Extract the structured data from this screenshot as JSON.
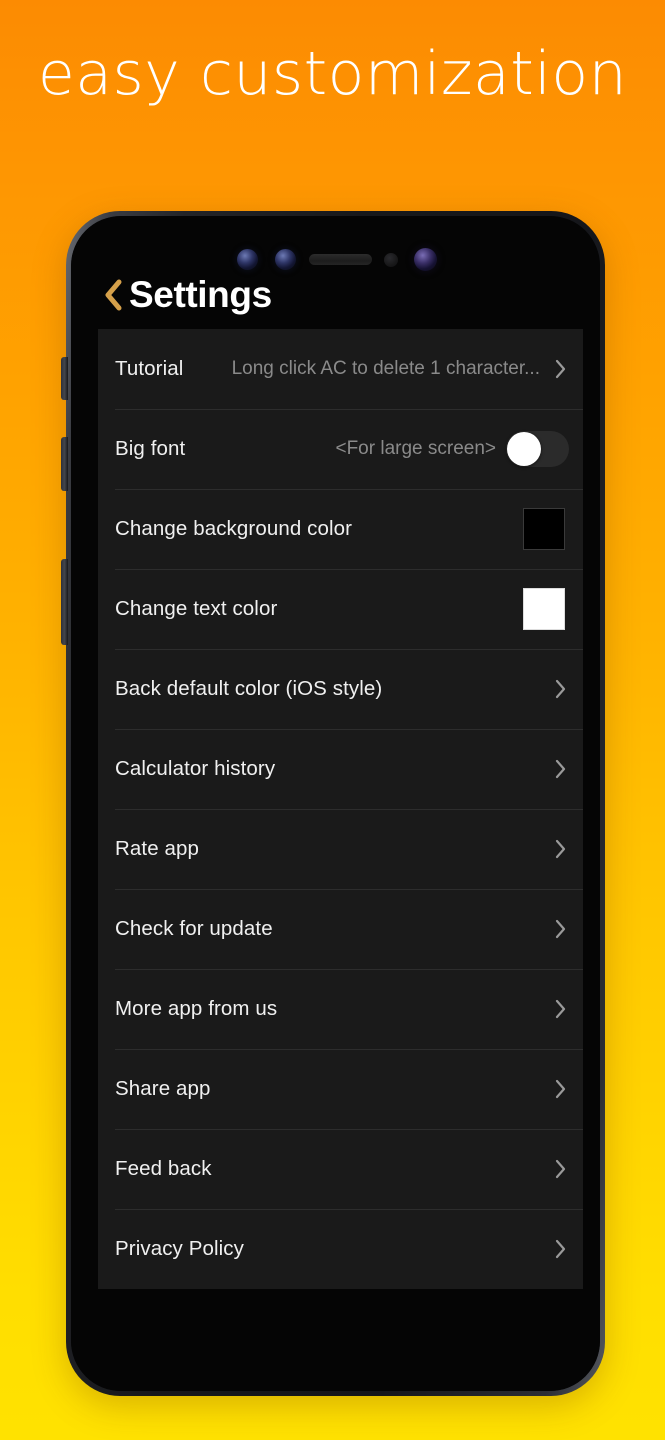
{
  "promo": {
    "headline": "easy customization",
    "background_gradient_top": "#FC8B02",
    "background_gradient_bottom": "#FFE200",
    "headline_color": "#FFFFFF"
  },
  "device": {
    "frame_color": "#17181b",
    "hardware": {
      "camera_left": "camera-lens",
      "camera_mid": "camera-lens",
      "speaker": "earpiece-speaker",
      "sensor": "proximity-sensor",
      "camera_right": "camera-lens"
    },
    "side_buttons": [
      "side-button-1",
      "side-button-2",
      "side-button-3"
    ]
  },
  "app": {
    "header": {
      "back_icon": "chevron-left-icon",
      "back_icon_color": "#D5A04A",
      "title": "Settings",
      "title_color": "#FFFFFF"
    },
    "screen_background": "#050505",
    "panel_background": "#1a1a1a",
    "divider_color": "#2d2d2d",
    "chevron_color": "#909090",
    "rows": [
      {
        "label": "Tutorial",
        "value": "Long click AC to delete 1 character...",
        "accessory": "chevron"
      },
      {
        "label": "Big font",
        "value": "<For large screen>",
        "accessory": "toggle",
        "toggle_on": false,
        "toggle_track_color": "#2b2b2b",
        "toggle_knob_color": "#FFFFFF"
      },
      {
        "label": "Change background color",
        "value": "",
        "accessory": "swatch",
        "swatch_color": "#000000"
      },
      {
        "label": "Change text color",
        "value": "",
        "accessory": "swatch",
        "swatch_color": "#FFFFFF"
      },
      {
        "label": "Back default color (iOS style)",
        "value": "",
        "accessory": "chevron"
      },
      {
        "label": "Calculator history",
        "value": "",
        "accessory": "chevron"
      },
      {
        "label": "Rate app",
        "value": "",
        "accessory": "chevron"
      },
      {
        "label": "Check for update",
        "value": "",
        "accessory": "chevron"
      },
      {
        "label": "More app from us",
        "value": "",
        "accessory": "chevron"
      },
      {
        "label": "Share app",
        "value": "",
        "accessory": "chevron"
      },
      {
        "label": "Feed back",
        "value": "",
        "accessory": "chevron"
      },
      {
        "label": "Privacy Policy",
        "value": "",
        "accessory": "chevron"
      }
    ]
  }
}
